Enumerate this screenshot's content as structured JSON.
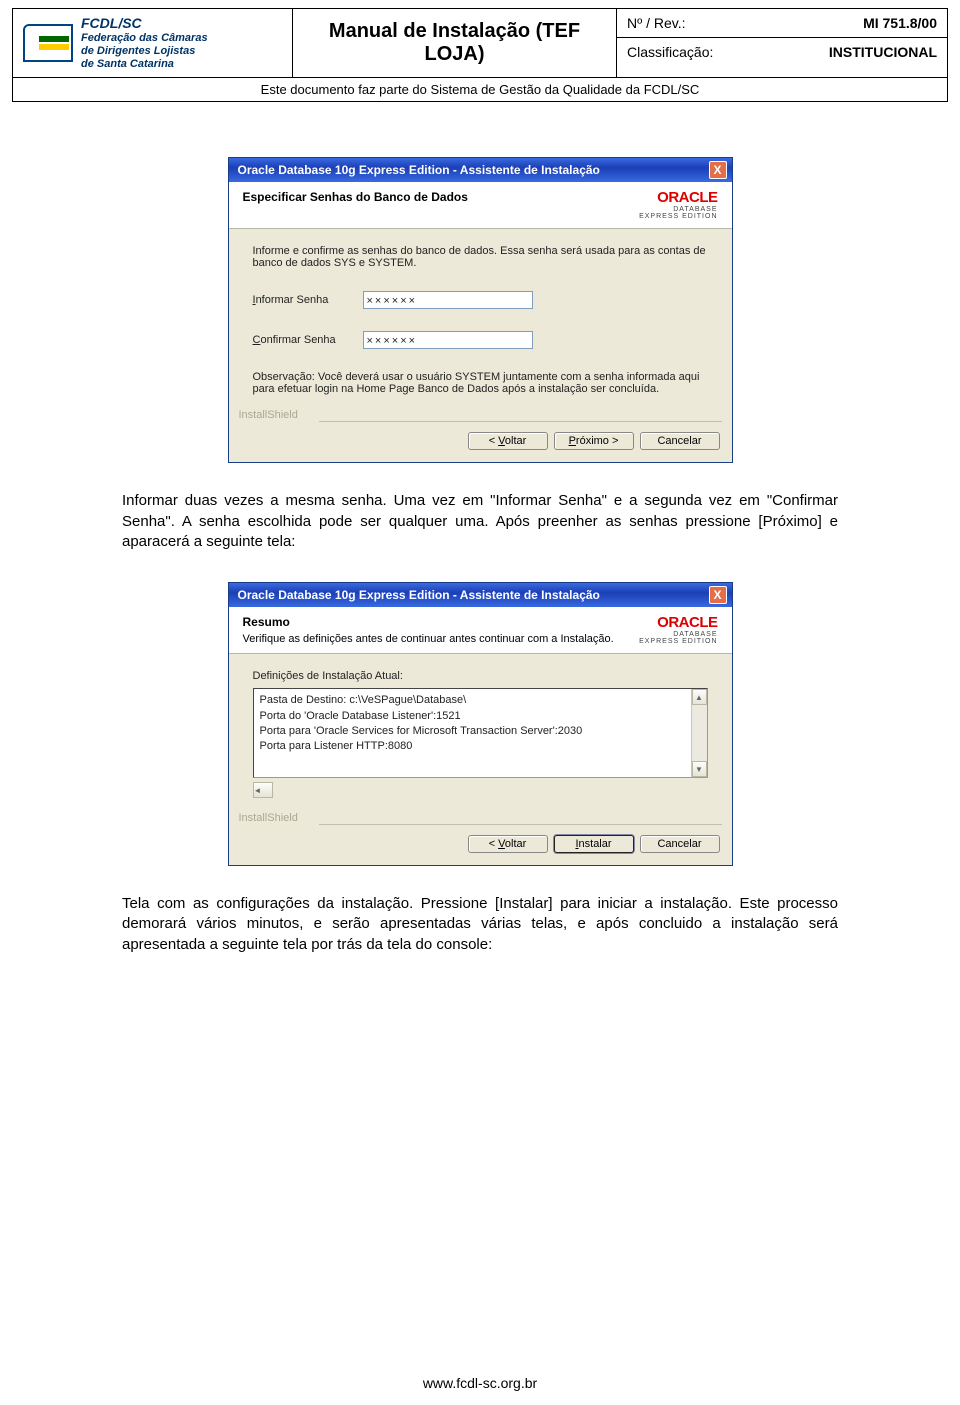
{
  "header": {
    "org_top": "FCDL/SC",
    "org_line1": "Federação das Câmaras",
    "org_line2": "de Dirigentes Lojistas",
    "org_line3": "de Santa Catarina",
    "title": "Manual de Instalação (TEF LOJA)",
    "num_rev_label": "Nº / Rev.:",
    "num_rev_value": "MI 751.8/00",
    "class_label": "Classificação:",
    "class_value": "INSTITUCIONAL",
    "subtitle": "Este documento faz parte do Sistema de Gestão da Qualidade da FCDL/SC"
  },
  "dialog1": {
    "title": "Oracle Database 10g Express Edition - Assistente de Instalação",
    "close": "X",
    "heading": "Especificar Senhas do Banco de Dados",
    "brand": "ORACLE",
    "brand_sub1": "DATABASE",
    "brand_sub2": "EXPRESS EDITION",
    "intro": "Informe e confirme as senhas do banco de dados. Essa senha será usada para as contas de banco de dados SYS e SYSTEM.",
    "lbl_inform": "Informar Senha",
    "lbl_confirm": "Confirmar Senha",
    "value_mask": "××××××",
    "note": "Observação: Você deverá usar o usuário SYSTEM juntamente com a senha informada aqui para efetuar login na Home Page Banco de Dados após a instalação ser concluída.",
    "installshield": "InstallShield",
    "btn_back": "< Voltar",
    "btn_next": "Próximo >",
    "btn_cancel": "Cancelar"
  },
  "para1": "Informar duas vezes a mesma senha. Uma vez em \"Informar Senha\" e a segunda vez em \"Confirmar Senha\". A senha escolhida pode ser qualquer uma. Após preenher as senhas pressione [Próximo] e aparacerá a seguinte tela:",
  "dialog2": {
    "title": "Oracle Database 10g Express Edition - Assistente de Instalação",
    "close": "X",
    "heading": "Resumo",
    "subheading": "Verifique as definições antes de continuar antes continuar com a Instalação.",
    "brand": "ORACLE",
    "brand_sub1": "DATABASE",
    "brand_sub2": "EXPRESS EDITION",
    "definitions_label": "Definições de Instalação Atual:",
    "line1": "Pasta de Destino: c:\\VeSPague\\Database\\",
    "line2": "Porta do 'Oracle Database Listener':1521",
    "line3": "Porta para 'Oracle Services for Microsoft Transaction Server':2030",
    "line4": "Porta para Listener HTTP:8080",
    "installshield": "InstallShield",
    "btn_back": "< Voltar",
    "btn_install": "Instalar",
    "btn_cancel": "Cancelar"
  },
  "para2": "Tela com as configurações da instalação. Pressione [Instalar] para iniciar a instalação. Este processo demorará vários minutos, e serão apresentadas várias telas, e após concluido a instalação será apresentada a seguinte tela por trás da tela do console:",
  "footer": "www.fcdl-sc.org.br"
}
